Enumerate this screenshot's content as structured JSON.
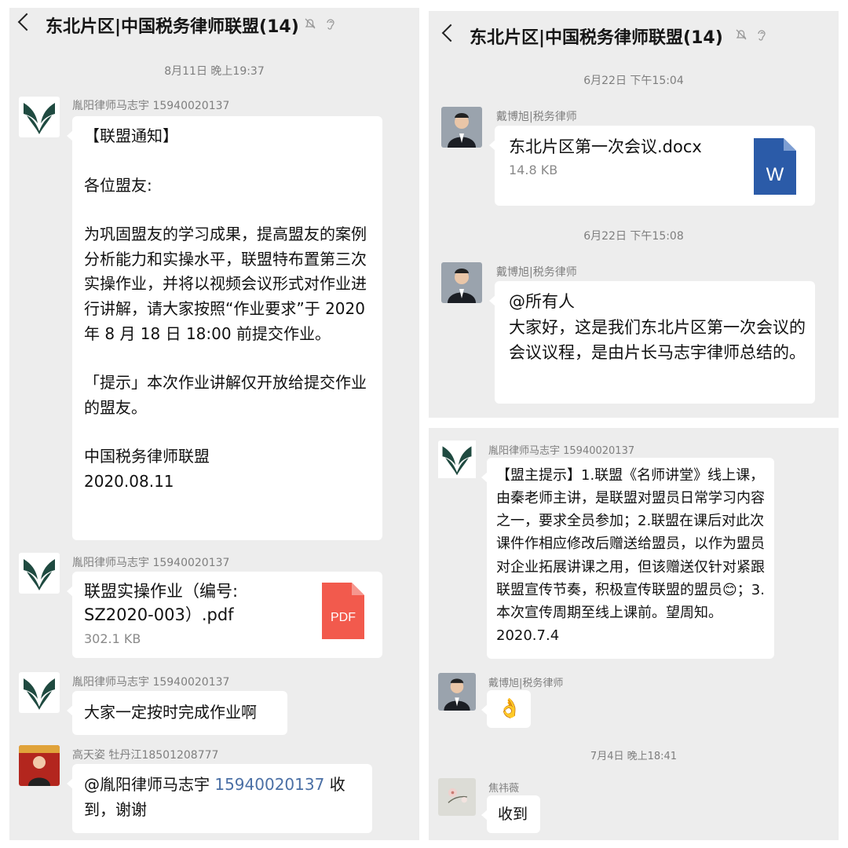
{
  "left": {
    "header": {
      "title": "东北片区|中国税务律师联盟(14)"
    },
    "timestamps": [
      "8月11日 晚上19:37"
    ],
    "messages": [
      {
        "sender": "胤阳律师马志宇 15940020137",
        "paragraphs": [
          "【联盟通知】",
          "各位盟友:",
          "为巩固盟友的学习成果，提高盟友的案例分析能力和实操水平，联盟特布置第三次实操作业，并将以视频会议形式对作业进行讲解，请大家按照“作业要求”于 2020 年 8 月 18 日 18:00 前提交作业。",
          "「提示」本次作业讲解仅开放给提交作业的盟友。",
          "中国税务律师联盟\n2020.08.11"
        ]
      },
      {
        "sender": "胤阳律师马志宇 15940020137",
        "file_name": "联盟实操作业（编号: SZ2020-003）.pdf",
        "file_size": "302.1 KB",
        "file_type": "PDF"
      },
      {
        "sender": "胤阳律师马志宇 15940020137",
        "text": "大家一定按时完成作业啊"
      },
      {
        "sender": "高天姿 牡丹江18501208777",
        "mention": "@胤阳律师马志宇",
        "mention_number": "15940020137",
        "text_after": "收到，谢谢"
      }
    ]
  },
  "right_top": {
    "header": {
      "title": "东北片区|中国税务律师联盟(14)"
    },
    "timestamps": [
      "6月22日 下午15:04",
      "6月22日 下午15:08"
    ],
    "messages": [
      {
        "sender": "戴博旭|税务律师",
        "file_name": "东北片区第一次会议.docx",
        "file_size": "14.8 KB",
        "file_type": "W"
      },
      {
        "sender": "戴博旭|税务律师",
        "text": "@所有人\n大家好，这是我们东北片区第一次会议的会议议程，是由片长马志宇律师总结的。"
      }
    ]
  },
  "right_bottom": {
    "timestamps": [
      "7月4日 晚上18:41"
    ],
    "messages": [
      {
        "sender": "胤阳律师马志宇 15940020137",
        "text": "【盟主提示】1.联盟《名师讲堂》线上课，由秦老师主讲，是联盟对盟员日常学习内容之一，要求全员参加；2.联盟在课后对此次课件作相应修改后赠送给盟员，以作为盟员对企业拓展讲课之用，但该赠送仅针对紧跟联盟宣传节奏，积极宣传联盟的盟员😊；3.本次宣传周期至线上课前。望周知。2020.7.4"
      },
      {
        "sender": "戴博旭|税务律师",
        "emoji": "👌"
      },
      {
        "sender": "焦祎薇",
        "text": "收到"
      }
    ]
  },
  "icons": {
    "back": "chevron-left-icon",
    "mute": "bell-muted-icon",
    "earpiece": "ear-icon",
    "pdf": "pdf-file-icon",
    "word": "word-file-icon"
  },
  "colors": {
    "chat_bg": "#ededed",
    "bubble_bg": "#ffffff",
    "pdf_red": "#f25a4d",
    "word_blue": "#2b5ba8",
    "mention_blue": "#4a6fa5",
    "logo_green": "#1f4a40"
  }
}
